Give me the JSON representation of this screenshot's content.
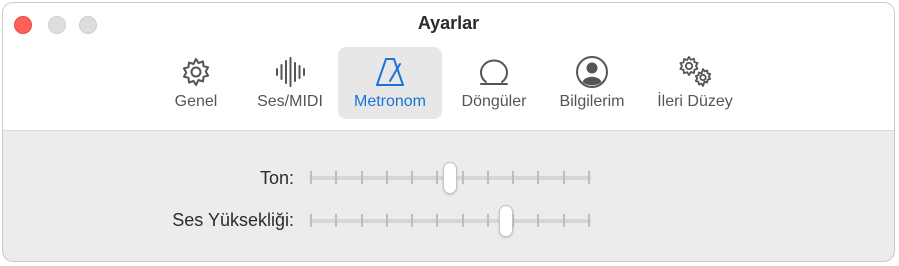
{
  "window": {
    "title": "Ayarlar",
    "controls": [
      "close",
      "minimize",
      "zoom"
    ]
  },
  "toolbar": {
    "selected": "metronome",
    "tabs": [
      {
        "id": "general",
        "label": "Genel",
        "icon": "gear-icon"
      },
      {
        "id": "audio-midi",
        "label": "Ses/MIDI",
        "icon": "waveform-icon"
      },
      {
        "id": "metronome",
        "label": "Metronom",
        "icon": "metronome-icon"
      },
      {
        "id": "loops",
        "label": "Döngüler",
        "icon": "loop-icon"
      },
      {
        "id": "account",
        "label": "Bilgilerim",
        "icon": "person-circle-icon"
      },
      {
        "id": "advanced",
        "label": "İleri Düzey",
        "icon": "gears-icon"
      }
    ]
  },
  "settings": {
    "tone": {
      "label": "Ton:",
      "value": 0.5,
      "ticks": 12
    },
    "volume": {
      "label": "Ses Yüksekliği:",
      "value": 0.7,
      "ticks": 12
    }
  },
  "colors": {
    "accent": "#1a73d9",
    "close": "#ff5f57",
    "inactive_control": "#dddddd"
  }
}
